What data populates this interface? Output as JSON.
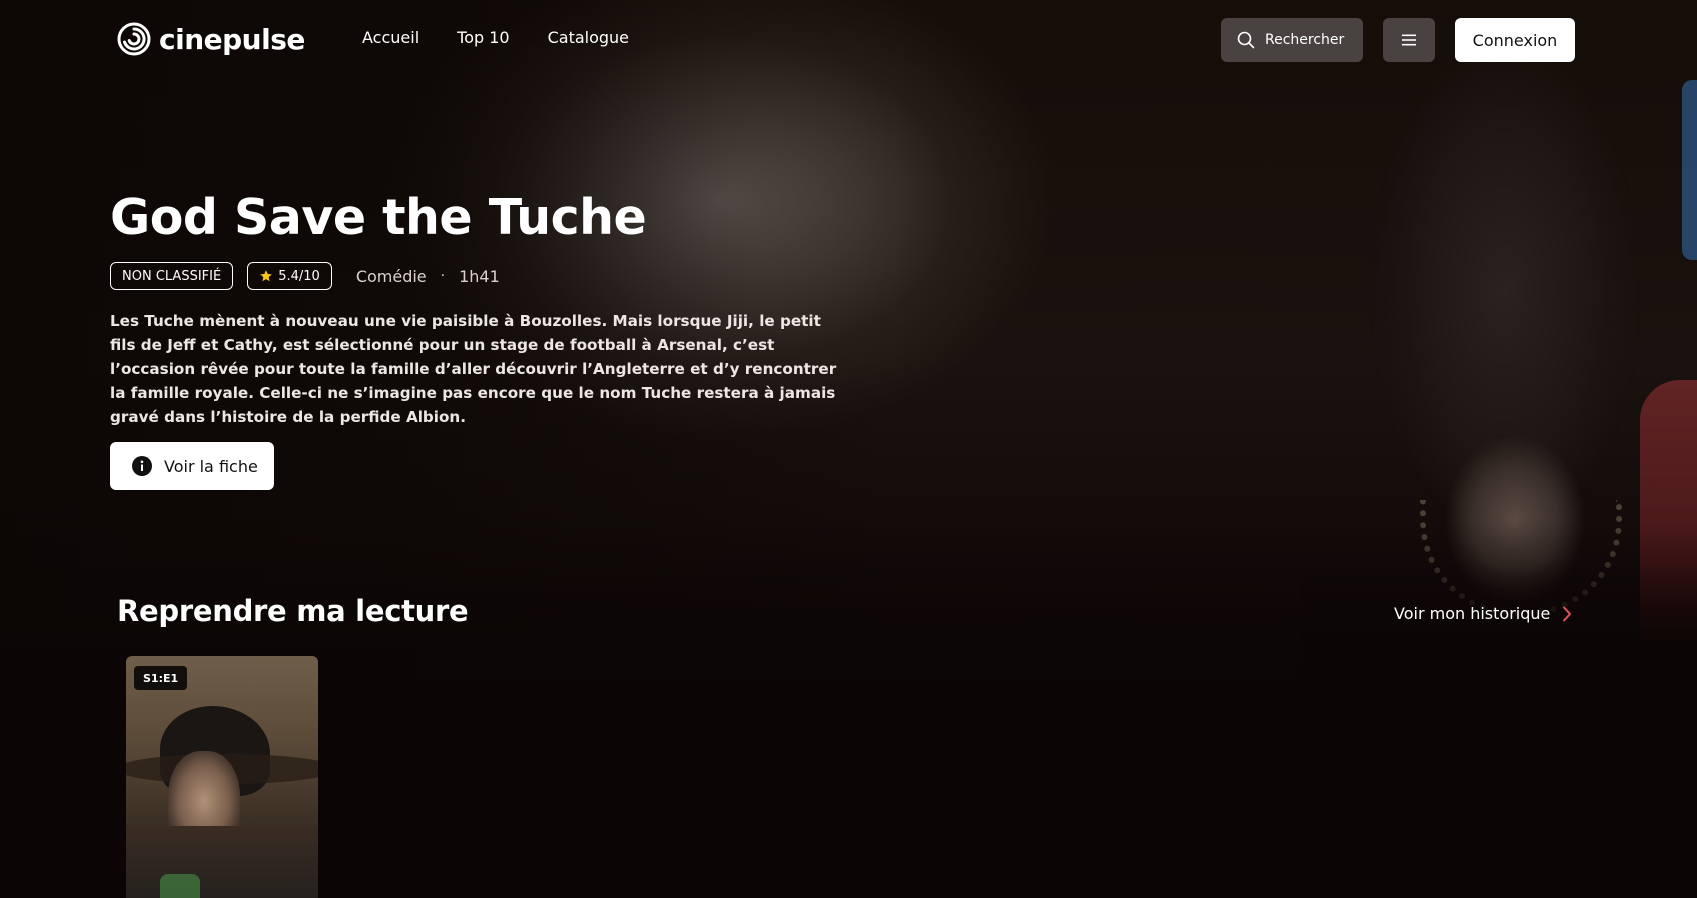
{
  "brand": {
    "name": "cinepulse"
  },
  "nav": {
    "items": [
      {
        "label": "Accueil"
      },
      {
        "label": "Top 10"
      },
      {
        "label": "Catalogue"
      }
    ]
  },
  "header": {
    "search_label": "Rechercher",
    "login_label": "Connexion"
  },
  "hero": {
    "title": "God Save the Tuche",
    "rating_badge": "NON CLASSIFIÉ",
    "score": "5.4/10",
    "genre": "Comédie",
    "separator": "·",
    "duration": "1h41",
    "synopsis": "Les Tuche mènent à nouveau une vie paisible à Bouzolles. Mais lorsque Jiji, le petit fils de Jeff et Cathy, est sélectionné pour un stage de football à Arsenal, c’est l’occasion rêvée pour toute la famille d’aller découvrir l’Angleterre et d’y rencontrer la famille royale. Celle-ci ne s’imagine pas encore que le nom Tuche restera à jamais gravé dans l’histoire de la perfide Albion.",
    "cta_label": "Voir la fiche"
  },
  "continue_watching": {
    "title": "Reprendre ma lecture",
    "history_link": "Voir mon historique",
    "items": [
      {
        "episode": "S1:E1"
      }
    ]
  },
  "colors": {
    "accent": "#e8505b",
    "background": "#0c0505",
    "star": "#f5c518"
  },
  "icons": {
    "logo": "spiral-icon",
    "search": "search-icon",
    "menu": "hamburger-icon",
    "info": "info-icon",
    "star": "star-icon",
    "chevron": "chevron-right-icon"
  }
}
